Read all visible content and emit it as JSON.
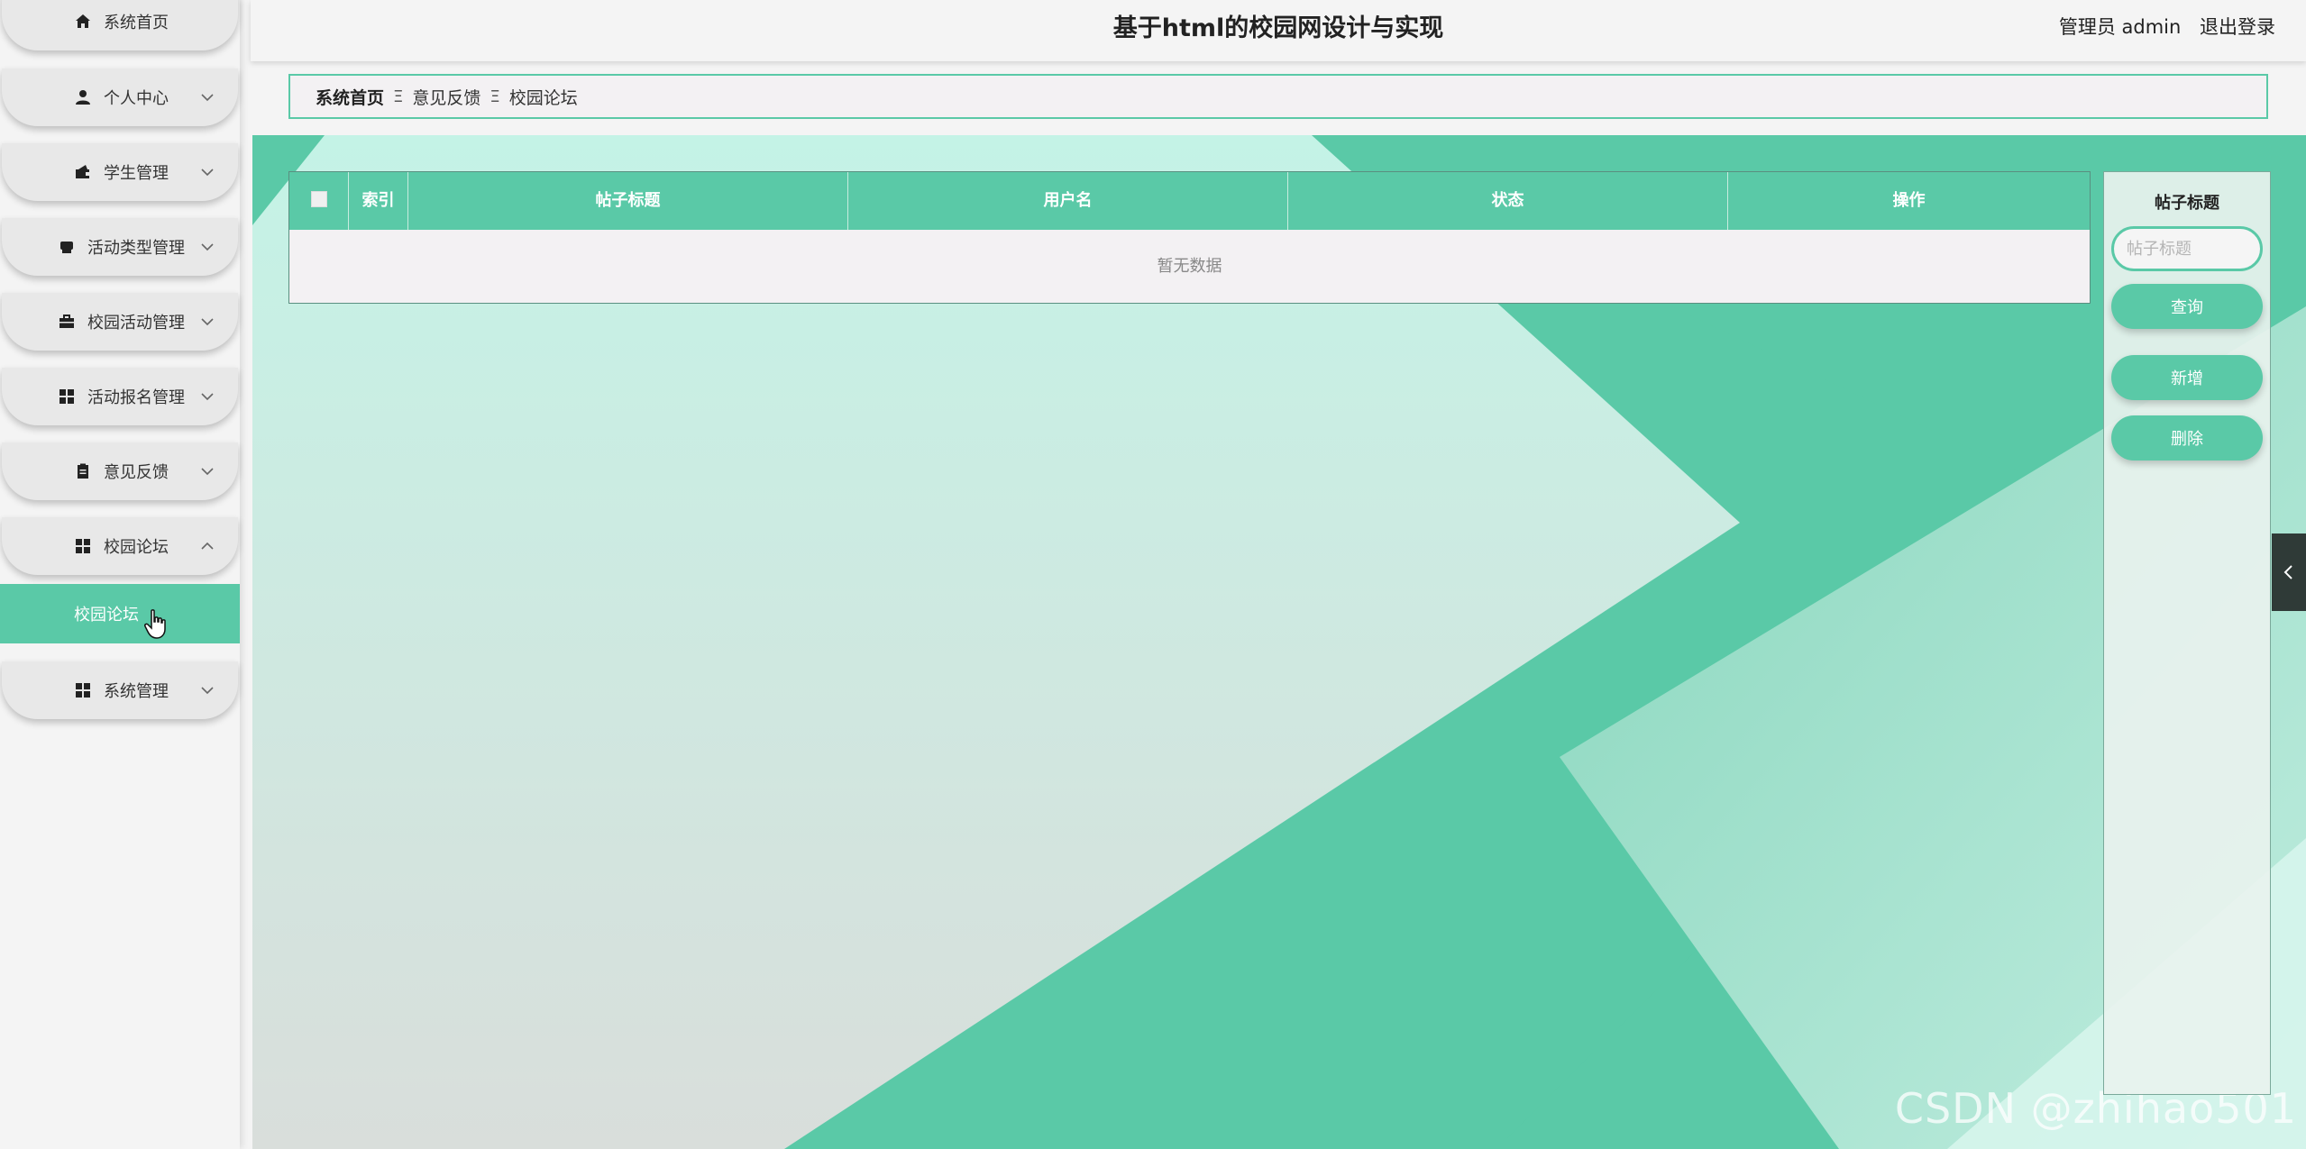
{
  "app": {
    "title": "基于html的校园网设计与实现",
    "user_label": "管理员 admin",
    "logout_label": "退出登录"
  },
  "sidebar": {
    "items": [
      {
        "label": "系统首页",
        "icon": "home-icon",
        "expandable": false
      },
      {
        "label": "个人中心",
        "icon": "user-icon",
        "expandable": true
      },
      {
        "label": "学生管理",
        "icon": "wallet-icon",
        "expandable": true
      },
      {
        "label": "活动类型管理",
        "icon": "printer-icon",
        "expandable": true
      },
      {
        "label": "校园活动管理",
        "icon": "briefcase-icon",
        "expandable": true
      },
      {
        "label": "活动报名管理",
        "icon": "grid-icon",
        "expandable": true
      },
      {
        "label": "意见反馈",
        "icon": "clipboard-icon",
        "expandable": true
      },
      {
        "label": "校园论坛",
        "icon": "grid-icon",
        "expandable": true,
        "expanded": true
      },
      {
        "label": "系统管理",
        "icon": "grid-icon",
        "expandable": true
      }
    ],
    "active_sub_item": "校园论坛"
  },
  "breadcrumb": {
    "items": [
      "系统首页",
      "意见反馈",
      "校园论坛"
    ],
    "separator": "Ξ"
  },
  "table": {
    "columns": [
      "",
      "索引",
      "帖子标题",
      "用户名",
      "状态",
      "操作"
    ],
    "empty_text": "暂无数据"
  },
  "search_panel": {
    "label": "帖子标题",
    "input_placeholder": "帖子标题",
    "input_value": "",
    "query_button": "查询",
    "add_button": "新增",
    "delete_button": "删除"
  },
  "watermark": "CSDN @zhihao501",
  "colors": {
    "accent": "#5ac9a7",
    "sidebar_bg": "#f4f4f4",
    "nav_item_bg": "#e8e8e8",
    "collapse_tab": "#2f3a37"
  }
}
